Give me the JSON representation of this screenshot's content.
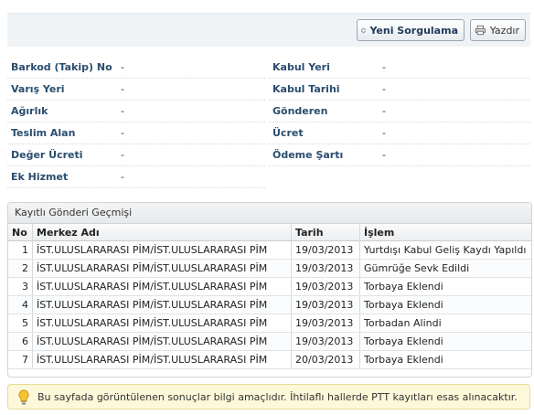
{
  "toolbar": {
    "new_query_label": "Yeni Sorgulama",
    "print_label": "Yazdır",
    "new_query_icon": "plus-icon",
    "print_icon": "printer-icon"
  },
  "details": {
    "left": [
      {
        "label": "Barkod (Takip) No",
        "value": "-"
      },
      {
        "label": "Varış Yeri",
        "value": "-"
      },
      {
        "label": "Ağırlık",
        "value": "-"
      },
      {
        "label": "Teslim Alan",
        "value": "-"
      },
      {
        "label": "Değer Ücreti",
        "value": "-"
      },
      {
        "label": "Ek Hizmet",
        "value": "-"
      }
    ],
    "right": [
      {
        "label": "Kabul Yeri",
        "value": "-"
      },
      {
        "label": "Kabul Tarihi",
        "value": "-"
      },
      {
        "label": "Gönderen",
        "value": "-"
      },
      {
        "label": "Ücret",
        "value": "-"
      },
      {
        "label": "Ödeme Şartı",
        "value": "-"
      }
    ]
  },
  "history": {
    "title": "Kayıtlı Gönderi Geçmişi",
    "columns": [
      "No",
      "Merkez Adı",
      "Tarih",
      "İşlem"
    ],
    "rows": [
      {
        "no": "1",
        "center": "İST.ULUSLARARASI PİM/İST.ULUSLARARASI PİM",
        "date": "19/03/2013",
        "action": "Yurtdışı Kabul Geliş Kaydı Yapıldı"
      },
      {
        "no": "2",
        "center": "İST.ULUSLARARASI PİM/İST.ULUSLARARASI PİM",
        "date": "19/03/2013",
        "action": "Gümrüğe Sevk Edildi"
      },
      {
        "no": "3",
        "center": "İST.ULUSLARARASI PİM/İST.ULUSLARARASI PİM",
        "date": "19/03/2013",
        "action": "Torbaya Eklendi"
      },
      {
        "no": "4",
        "center": "İST.ULUSLARARASI PİM/İST.ULUSLARARASI PİM",
        "date": "19/03/2013",
        "action": "Torbaya Eklendi"
      },
      {
        "no": "5",
        "center": "İST.ULUSLARARASI PİM/İST.ULUSLARARASI PİM",
        "date": "19/03/2013",
        "action": "Torbadan Alindi"
      },
      {
        "no": "6",
        "center": "İST.ULUSLARARASI PİM/İST.ULUSLARARASI PİM",
        "date": "19/03/2013",
        "action": "Torbaya Eklendi"
      },
      {
        "no": "7",
        "center": "İST.ULUSLARARASI PİM/İST.ULUSLARARASI PİM",
        "date": "20/03/2013",
        "action": "Torbaya Eklendi"
      }
    ]
  },
  "notice": {
    "text": "Bu sayfada görüntülenen sonuçlar bilgi amaçlıdır. İhtilaflı hallerde PTT kayıtları esas alınacaktır.",
    "icon": "lightbulb-icon"
  }
}
